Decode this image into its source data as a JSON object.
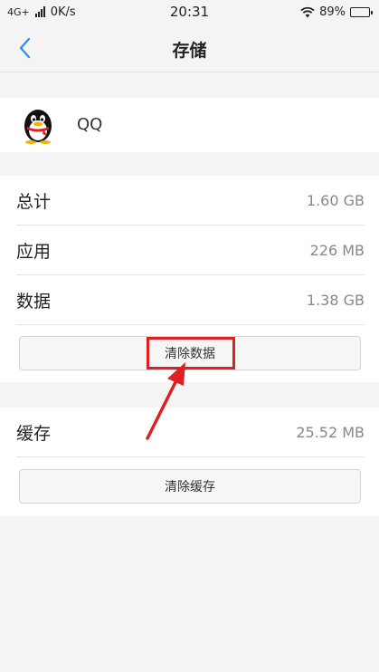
{
  "status_bar": {
    "network": "4G+",
    "speed": "0K/s",
    "time": "20:31",
    "battery": "89%",
    "battery_level": 0.89
  },
  "nav": {
    "title": "存储",
    "back_icon": "chevron-left-icon"
  },
  "app": {
    "name": "QQ",
    "icon": "qq-penguin-icon"
  },
  "storage": {
    "rows": [
      {
        "label": "总计",
        "value": "1.60 GB"
      },
      {
        "label": "应用",
        "value": "226 MB"
      },
      {
        "label": "数据",
        "value": "1.38 GB"
      }
    ],
    "clear_data_label": "清除数据"
  },
  "cache": {
    "label": "缓存",
    "value": "25.52 MB",
    "clear_cache_label": "清除缓存"
  },
  "colors": {
    "accent": "#2d8cf0",
    "annotation": "#e02020"
  }
}
